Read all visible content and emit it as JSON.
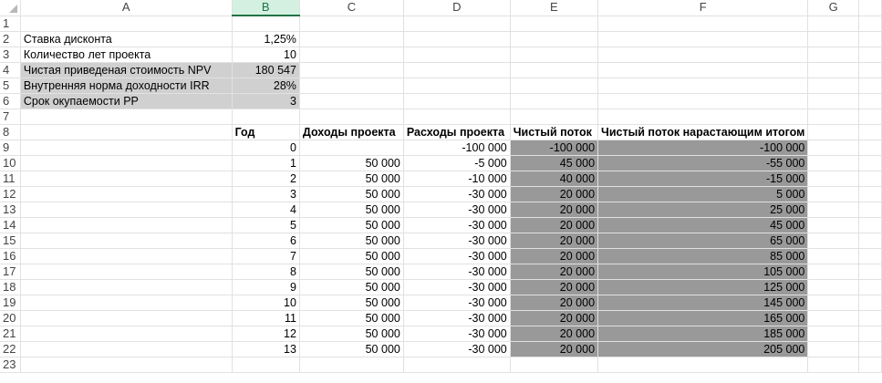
{
  "columns": [
    "A",
    "B",
    "C",
    "D",
    "E",
    "F",
    "G"
  ],
  "selected_column": "B",
  "rows": [
    "1",
    "2",
    "3",
    "4",
    "5",
    "6",
    "7",
    "8",
    "9",
    "10",
    "11",
    "12",
    "13",
    "14",
    "15",
    "16",
    "17",
    "18",
    "19",
    "20",
    "21",
    "22",
    "23"
  ],
  "params": [
    {
      "label": "Ставка дисконта",
      "value": "1,25%"
    },
    {
      "label": "Количество лет проекта",
      "value": "10"
    },
    {
      "label": "Чистая приведеная стоимость NPV",
      "value": "180 547"
    },
    {
      "label": "Внутренняя норма доходности IRR",
      "value": "28%"
    },
    {
      "label": "Срок окупаемости PP",
      "value": "3"
    }
  ],
  "table_headers": [
    "Год",
    "Доходы проекта",
    "Расходы проекта",
    "Чистый поток",
    "Чистый поток нарастающим итогом"
  ],
  "table_rows": [
    [
      "0",
      "",
      "-100 000",
      "-100 000",
      "-100 000"
    ],
    [
      "1",
      "50 000",
      "-5 000",
      "45 000",
      "-55 000"
    ],
    [
      "2",
      "50 000",
      "-10 000",
      "40 000",
      "-15 000"
    ],
    [
      "3",
      "50 000",
      "-30 000",
      "20 000",
      "5 000"
    ],
    [
      "4",
      "50 000",
      "-30 000",
      "20 000",
      "25 000"
    ],
    [
      "5",
      "50 000",
      "-30 000",
      "20 000",
      "45 000"
    ],
    [
      "6",
      "50 000",
      "-30 000",
      "20 000",
      "65 000"
    ],
    [
      "7",
      "50 000",
      "-30 000",
      "20 000",
      "85 000"
    ],
    [
      "8",
      "50 000",
      "-30 000",
      "20 000",
      "105 000"
    ],
    [
      "9",
      "50 000",
      "-30 000",
      "20 000",
      "125 000"
    ],
    [
      "10",
      "50 000",
      "-30 000",
      "20 000",
      "145 000"
    ],
    [
      "11",
      "50 000",
      "-30 000",
      "20 000",
      "165 000"
    ],
    [
      "12",
      "50 000",
      "-30 000",
      "20 000",
      "185 000"
    ],
    [
      "13",
      "50 000",
      "-30 000",
      "20 000",
      "205 000"
    ]
  ],
  "colors": {
    "selected_header_bg": "#d3f0e0",
    "selected_header_accent": "#217346",
    "param_fill": "#d0d0d0",
    "flow_fill": "#999999"
  }
}
